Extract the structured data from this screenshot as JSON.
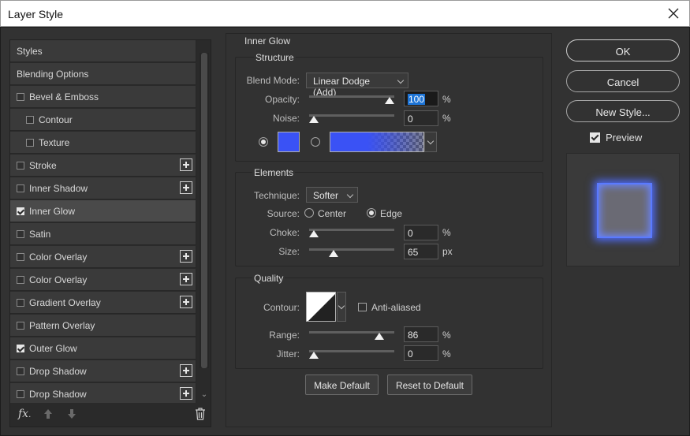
{
  "window": {
    "title": "Layer Style"
  },
  "styles_list": {
    "items": [
      {
        "label": "Styles",
        "has_checkbox": false,
        "checked": false,
        "indent": 0,
        "has_plus": false,
        "selected": false
      },
      {
        "label": "Blending Options",
        "has_checkbox": false,
        "checked": false,
        "indent": 0,
        "has_plus": false,
        "selected": false
      },
      {
        "label": "Bevel & Emboss",
        "has_checkbox": true,
        "checked": false,
        "indent": 0,
        "has_plus": false,
        "selected": false
      },
      {
        "label": "Contour",
        "has_checkbox": true,
        "checked": false,
        "indent": 1,
        "has_plus": false,
        "selected": false
      },
      {
        "label": "Texture",
        "has_checkbox": true,
        "checked": false,
        "indent": 1,
        "has_plus": false,
        "selected": false
      },
      {
        "label": "Stroke",
        "has_checkbox": true,
        "checked": false,
        "indent": 0,
        "has_plus": true,
        "selected": false
      },
      {
        "label": "Inner Shadow",
        "has_checkbox": true,
        "checked": false,
        "indent": 0,
        "has_plus": true,
        "selected": false
      },
      {
        "label": "Inner Glow",
        "has_checkbox": true,
        "checked": true,
        "indent": 0,
        "has_plus": false,
        "selected": true
      },
      {
        "label": "Satin",
        "has_checkbox": true,
        "checked": false,
        "indent": 0,
        "has_plus": false,
        "selected": false
      },
      {
        "label": "Color Overlay",
        "has_checkbox": true,
        "checked": false,
        "indent": 0,
        "has_plus": true,
        "selected": false
      },
      {
        "label": "Color Overlay",
        "has_checkbox": true,
        "checked": false,
        "indent": 0,
        "has_plus": true,
        "selected": false
      },
      {
        "label": "Gradient Overlay",
        "has_checkbox": true,
        "checked": false,
        "indent": 0,
        "has_plus": true,
        "selected": false
      },
      {
        "label": "Pattern Overlay",
        "has_checkbox": true,
        "checked": false,
        "indent": 0,
        "has_plus": false,
        "selected": false
      },
      {
        "label": "Outer Glow",
        "has_checkbox": true,
        "checked": true,
        "indent": 0,
        "has_plus": false,
        "selected": false
      },
      {
        "label": "Drop Shadow",
        "has_checkbox": true,
        "checked": false,
        "indent": 0,
        "has_plus": true,
        "selected": false
      },
      {
        "label": "Drop Shadow",
        "has_checkbox": true,
        "checked": false,
        "indent": 0,
        "has_plus": true,
        "selected": false
      }
    ],
    "footer_icon": "fx-icon"
  },
  "inner_glow": {
    "title": "Inner Glow",
    "structure": {
      "title": "Structure",
      "blend_mode_label": "Blend Mode:",
      "blend_mode_value": "Linear Dodge (Add)",
      "opacity_label": "Opacity:",
      "opacity_value": "100",
      "opacity_unit": "%",
      "opacity_level": 1.0,
      "noise_label": "Noise:",
      "noise_value": "0",
      "noise_unit": "%",
      "noise_level": 0.0,
      "color": "#3a52f5",
      "color_mode": "solid"
    },
    "elements": {
      "title": "Elements",
      "technique_label": "Technique:",
      "technique_value": "Softer",
      "source_label": "Source:",
      "source_center": "Center",
      "source_edge": "Edge",
      "source_selected": "Edge",
      "choke_label": "Choke:",
      "choke_value": "0",
      "choke_unit": "%",
      "choke_level": 0.0,
      "size_label": "Size:",
      "size_value": "65",
      "size_unit": "px",
      "size_level": 0.26
    },
    "quality": {
      "title": "Quality",
      "contour_label": "Contour:",
      "anti_aliased_label": "Anti-aliased",
      "anti_aliased": false,
      "range_label": "Range:",
      "range_value": "86",
      "range_unit": "%",
      "range_level": 0.86,
      "jitter_label": "Jitter:",
      "jitter_value": "0",
      "jitter_unit": "%",
      "jitter_level": 0.0
    },
    "make_default_label": "Make Default",
    "reset_default_label": "Reset to Default"
  },
  "actions": {
    "ok_label": "OK",
    "cancel_label": "Cancel",
    "new_style_label": "New Style...",
    "preview_label": "Preview",
    "preview_checked": true
  }
}
